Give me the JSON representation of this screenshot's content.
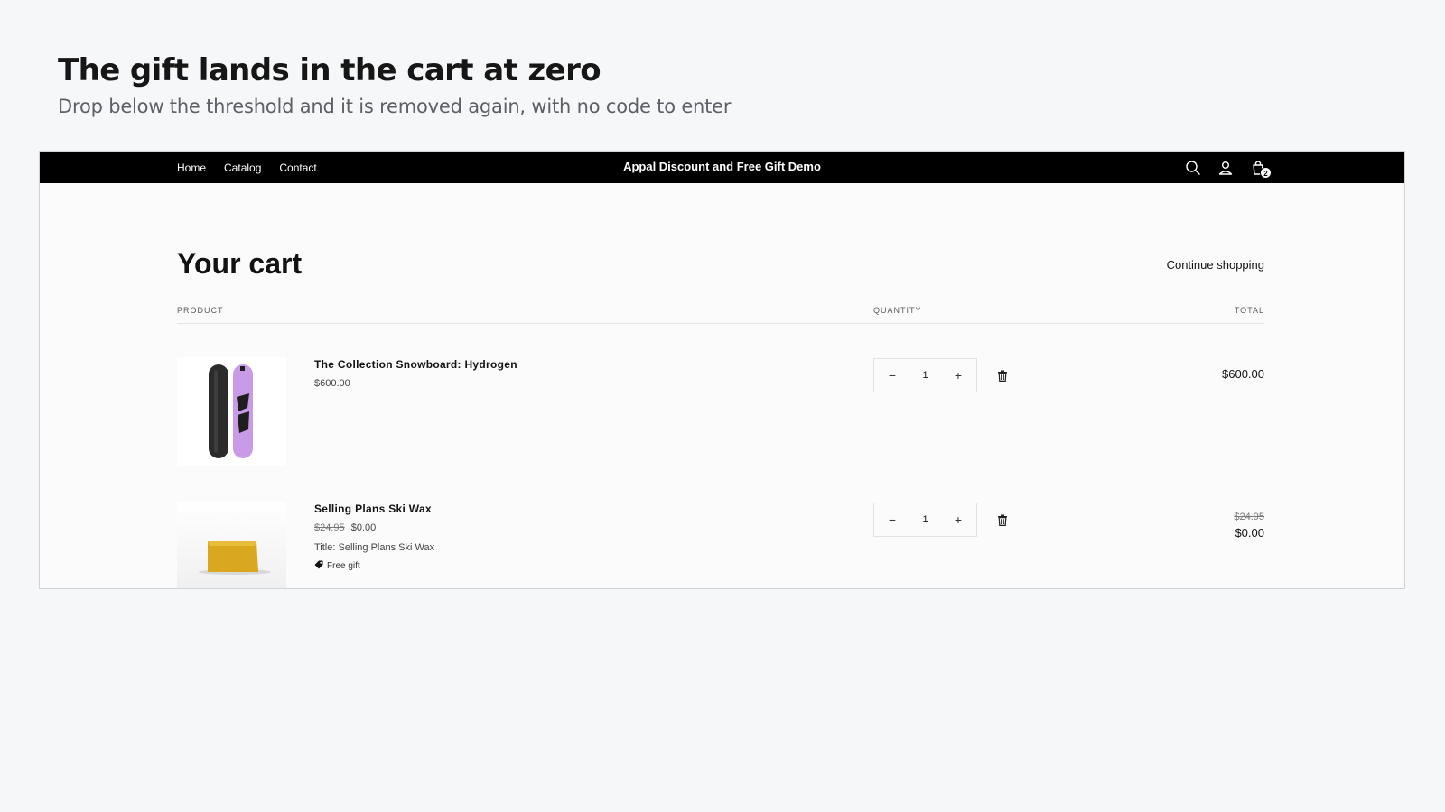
{
  "promo": {
    "title": "The gift lands in the cart at zero",
    "subtitle": "Drop below the threshold and it is removed again, with no code to enter"
  },
  "header": {
    "nav": [
      "Home",
      "Catalog",
      "Contact"
    ],
    "store_name": "Appal Discount and Free Gift Demo",
    "cart_count": "2",
    "icons": [
      "search-icon",
      "account-icon",
      "cart-icon"
    ]
  },
  "cart": {
    "title": "Your cart",
    "continue_label": "Continue shopping",
    "columns": {
      "product": "PRODUCT",
      "quantity": "QUANTITY",
      "total": "TOTAL"
    },
    "items": [
      {
        "name": "The Collection Snowboard: Hydrogen",
        "price": "$600.00",
        "quantity": "1",
        "total": "$600.00"
      },
      {
        "name": "Selling Plans Ski Wax",
        "original_price": "$24.95",
        "price": "$0.00",
        "attribute": "Title: Selling Plans Ski Wax",
        "badge": "Free gift",
        "quantity": "1",
        "original_total": "$24.95",
        "total": "$0.00"
      }
    ],
    "quantity_controls": {
      "minus": "−",
      "plus": "+"
    }
  },
  "colors": {
    "header_bg": "#000000",
    "page_bg": "#f6f7f9",
    "snowboard_purple": "#c99be6",
    "wax_yellow": "#d9a81f"
  }
}
